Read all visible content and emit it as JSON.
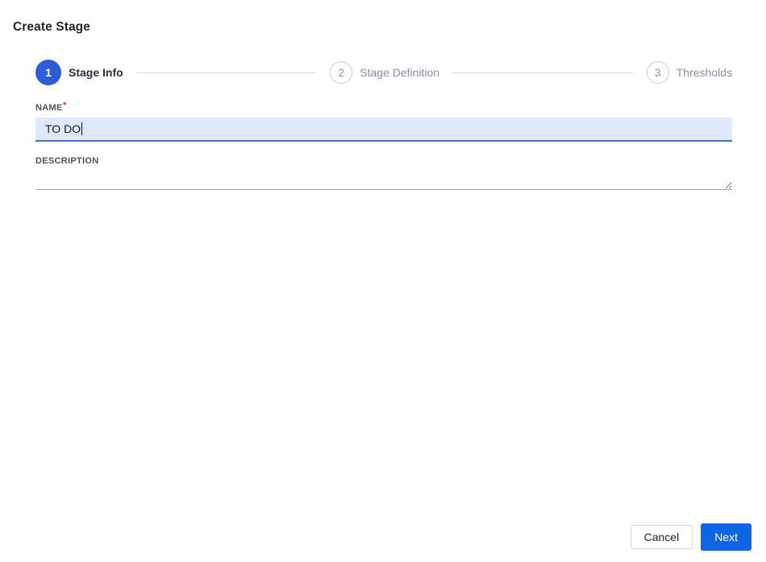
{
  "header": {
    "title": "Create Stage"
  },
  "stepper": {
    "steps": [
      {
        "number": "1",
        "label": "Stage Info",
        "state": "active"
      },
      {
        "number": "2",
        "label": "Stage Definition",
        "state": "upcoming"
      },
      {
        "number": "3",
        "label": "Thresholds",
        "state": "upcoming"
      }
    ]
  },
  "form": {
    "name": {
      "label": "NAME",
      "required_marker": "*",
      "value": "TO DO"
    },
    "description": {
      "label": "DESCRIPTION",
      "value": ""
    }
  },
  "footer": {
    "cancel_label": "Cancel",
    "next_label": "Next"
  },
  "colors": {
    "active_step_blue": "#2e5cd6",
    "next_button_blue": "#0c66e4",
    "input_focus_bg": "#dfe9fb",
    "input_focus_border": "#3b6fdd",
    "required_red": "#de350b"
  }
}
